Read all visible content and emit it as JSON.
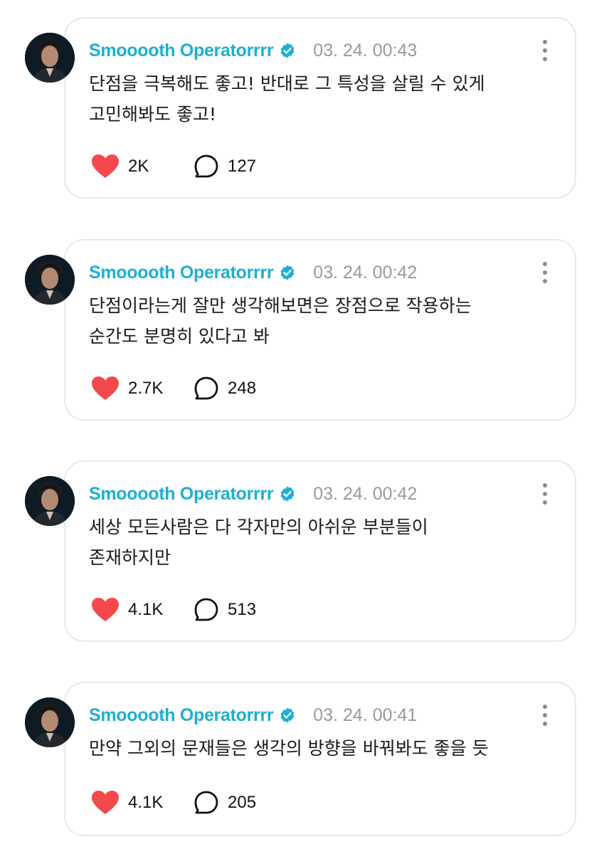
{
  "colors": {
    "username": "#1cb0d4",
    "verified_badge": "#1cb0d4",
    "timestamp": "#9a9a9a",
    "heart": "#f4494c",
    "card_border": "#e8e8ea"
  },
  "icons": {
    "verified": "verified-badge-icon",
    "like": "heart-icon",
    "reply": "speech-bubble-icon",
    "more": "more-vertical-icon"
  },
  "posts": [
    {
      "username": "Smooooth Operatorrrr",
      "timestamp": "03. 24. 00:43",
      "lines": [
        "단점을 극복해도 좋고! 반대로 그 특성을 살릴 수 있게",
        "고민해봐도 좋고!"
      ],
      "likes": "2K",
      "replies": "127"
    },
    {
      "username": "Smooooth Operatorrrr",
      "timestamp": "03. 24. 00:42",
      "lines": [
        "단점이라는게 잘만 생각해보면은 장점으로 작용하는",
        "순간도 분명히 있다고 봐"
      ],
      "likes": "2.7K",
      "replies": "248"
    },
    {
      "username": "Smooooth Operatorrrr",
      "timestamp": "03. 24. 00:42",
      "lines": [
        "세상 모든사람은 다 각자만의 아쉬운 부분들이",
        "존재하지만"
      ],
      "likes": "4.1K",
      "replies": "513"
    },
    {
      "username": "Smooooth Operatorrrr",
      "timestamp": "03. 24. 00:41",
      "lines": [
        "만약 그외의 문재들은 생각의 방향을 바꿔봐도 좋을 듯"
      ],
      "likes": "4.1K",
      "replies": "205"
    }
  ]
}
